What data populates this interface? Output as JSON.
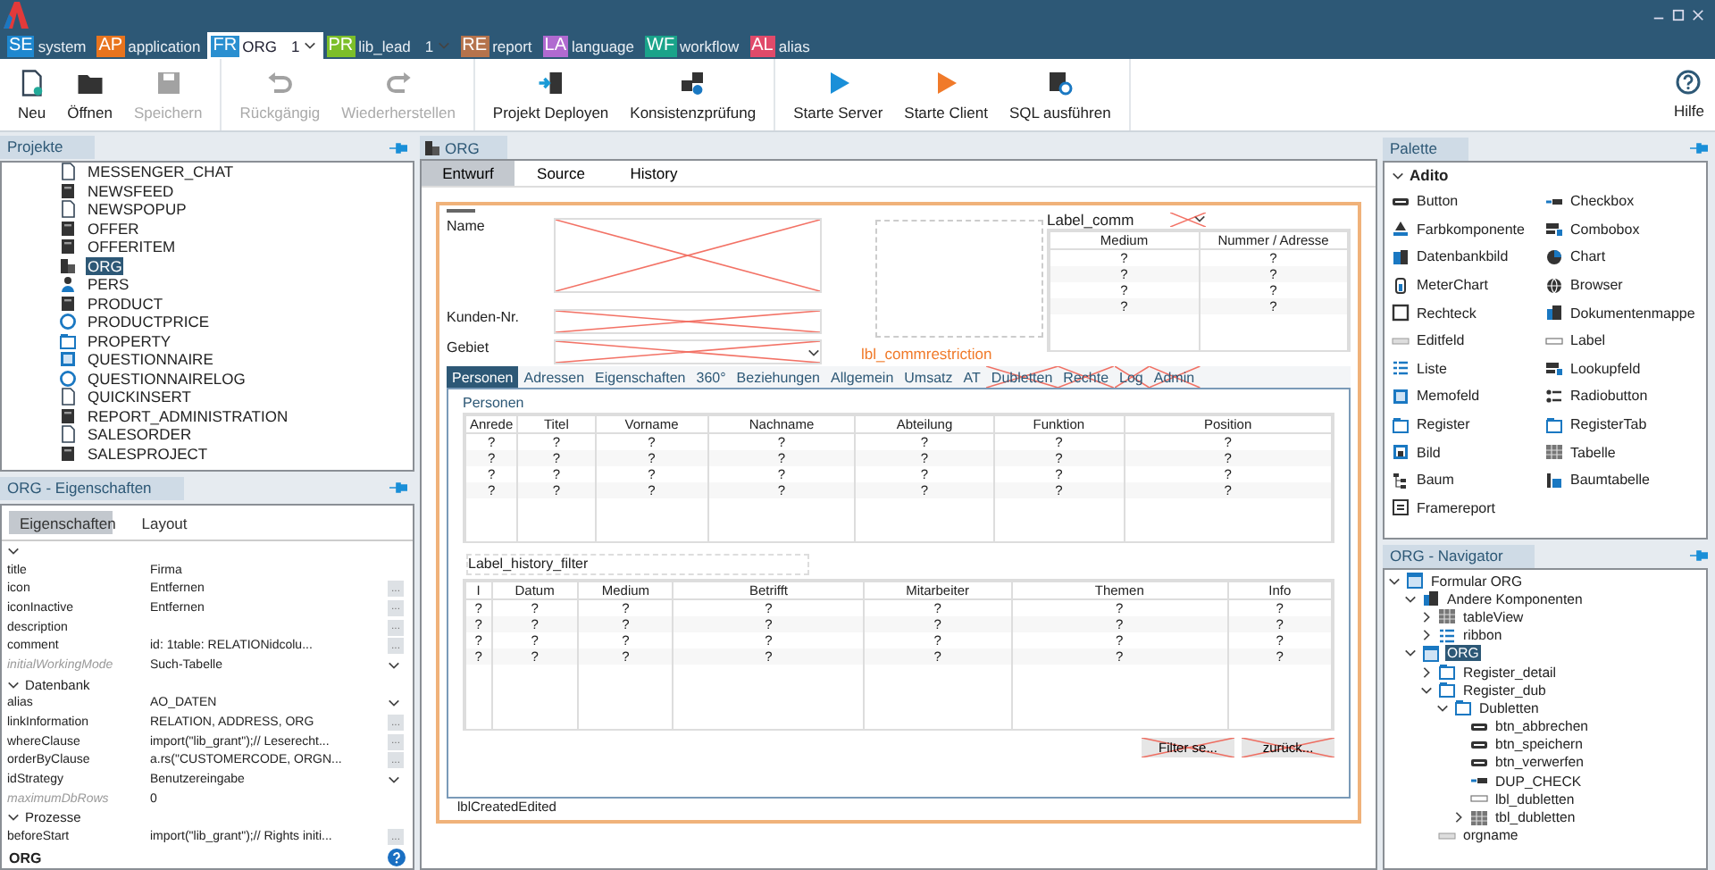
{
  "app_tabs": [
    {
      "code": "SE",
      "label": "system",
      "color": "#1e88d0",
      "selected": false
    },
    {
      "code": "AP",
      "label": "application",
      "color": "#e8741e",
      "selected": false
    },
    {
      "code": "FR",
      "label": "ORG",
      "color": "#2a8fd0",
      "selected": true,
      "count": "1"
    },
    {
      "code": "PR",
      "label": "lib_lead",
      "color": "#7cbf2a",
      "selected": false,
      "count": "1"
    },
    {
      "code": "RE",
      "label": "report",
      "color": "#b5734c",
      "selected": false
    },
    {
      "code": "LA",
      "label": "language",
      "color": "#b06ad0",
      "selected": false
    },
    {
      "code": "WF",
      "label": "workflow",
      "color": "#1aa38a",
      "selected": false
    },
    {
      "code": "AL",
      "label": "alias",
      "color": "#e04a6a",
      "selected": false
    }
  ],
  "toolbar": {
    "groups": [
      [
        {
          "label": "Neu",
          "kind": "new",
          "disabled": false
        },
        {
          "label": "Öffnen",
          "kind": "open",
          "disabled": false
        },
        {
          "label": "Speichern",
          "kind": "save",
          "disabled": true
        }
      ],
      [
        {
          "label": "Rückgängig",
          "kind": "undo",
          "disabled": true
        },
        {
          "label": "Wiederherstellen",
          "kind": "redo",
          "disabled": true
        }
      ],
      [
        {
          "label": "Projekt Deployen",
          "kind": "deploy",
          "disabled": false
        },
        {
          "label": "Konsistenzprüfung",
          "kind": "check",
          "disabled": false
        }
      ],
      [
        {
          "label": "Starte Server",
          "kind": "play",
          "color": "#1a8fd8",
          "disabled": false
        },
        {
          "label": "Starte Client",
          "kind": "play",
          "color": "#f07a2a",
          "disabled": false
        },
        {
          "label": "SQL ausführen",
          "kind": "sql",
          "disabled": false
        }
      ]
    ],
    "help": "Hilfe"
  },
  "projects": {
    "title": "Projekte",
    "items": [
      {
        "label": "MESSENGER_CHAT",
        "kind": "doc",
        "selected": false
      },
      {
        "label": "NEWSFEED",
        "kind": "block",
        "selected": false
      },
      {
        "label": "NEWSPOPUP",
        "kind": "doc",
        "selected": false
      },
      {
        "label": "OFFER",
        "kind": "block",
        "selected": false
      },
      {
        "label": "OFFERITEM",
        "kind": "block",
        "selected": false
      },
      {
        "label": "ORG",
        "kind": "building",
        "selected": true
      },
      {
        "label": "PERS",
        "kind": "person",
        "selected": false
      },
      {
        "label": "PRODUCT",
        "kind": "block",
        "selected": false
      },
      {
        "label": "PRODUCTPRICE",
        "kind": "circle",
        "selected": false
      },
      {
        "label": "PROPERTY",
        "kind": "tabs",
        "selected": false
      },
      {
        "label": "QUESTIONNAIRE",
        "kind": "memo",
        "selected": false
      },
      {
        "label": "QUESTIONNAIRELOG",
        "kind": "circle",
        "selected": false
      },
      {
        "label": "QUICKINSERT",
        "kind": "doc",
        "selected": false
      },
      {
        "label": "REPORT_ADMINISTRATION",
        "kind": "block",
        "selected": false
      },
      {
        "label": "SALESORDER",
        "kind": "doc",
        "selected": false
      },
      {
        "label": "SALESPROJECT",
        "kind": "block",
        "selected": false
      }
    ]
  },
  "properties": {
    "title": "ORG - Eigenschaften",
    "tabs": [
      {
        "label": "Eigenschaften",
        "selected": true
      },
      {
        "label": "Layout",
        "selected": false
      }
    ],
    "rows": [
      {
        "kind": "section",
        "expanded": true
      },
      {
        "kind": "prop",
        "name": "title",
        "value": "Firma",
        "disabled": false,
        "dropdown": false
      },
      {
        "kind": "prop",
        "name": "icon",
        "value": "Entfernen",
        "button": "...",
        "disabled": false,
        "dropdown": false
      },
      {
        "kind": "prop",
        "name": "iconInactive",
        "value": "Entfernen",
        "button": "...",
        "disabled": false,
        "dropdown": false
      },
      {
        "kind": "prop",
        "name": "description",
        "button": "...",
        "disabled": false,
        "dropdown": false
      },
      {
        "kind": "prop",
        "name": "comment",
        "value": "id: 1table: RELATIONidcolu...",
        "button": "...",
        "disabled": false,
        "dropdown": false
      },
      {
        "kind": "prop",
        "name": "initialWorkingMode",
        "value": "Such-Tabelle",
        "disabled": true,
        "dropdown": true
      },
      {
        "kind": "section",
        "label": "Datenbank",
        "expanded": true
      },
      {
        "kind": "prop",
        "name": "alias",
        "value": "AO_DATEN",
        "disabled": false,
        "dropdown": true
      },
      {
        "kind": "prop",
        "name": "linkInformation",
        "value": "RELATION, ADDRESS, ORG",
        "button": "...",
        "disabled": false,
        "dropdown": false
      },
      {
        "kind": "prop",
        "name": "whereClause",
        "value": "import(\"lib_grant\");// Leserecht...",
        "button": "...",
        "disabled": false,
        "dropdown": false
      },
      {
        "kind": "prop",
        "name": "orderByClause",
        "value": "a.rs(\"CUSTOMERCODE, ORGN...",
        "button": "...",
        "disabled": false,
        "dropdown": false
      },
      {
        "kind": "prop",
        "name": "idStrategy",
        "value": "Benutzereingabe",
        "disabled": false,
        "dropdown": true
      },
      {
        "kind": "prop",
        "name": "maximumDbRows",
        "value": "0",
        "disabled": true,
        "dropdown": false
      },
      {
        "kind": "section",
        "label": "Prozesse",
        "expanded": true
      },
      {
        "kind": "prop",
        "name": "beforeStart",
        "value": "import(\"lib_grant\");// Rights initi...",
        "button": "...",
        "disabled": false,
        "dropdown": false
      }
    ],
    "status": "ORG"
  },
  "editor": {
    "tab": "ORG",
    "views": [
      {
        "label": "Entwurf",
        "selected": true
      },
      {
        "label": "Source",
        "selected": false
      },
      {
        "label": "History",
        "selected": false
      }
    ],
    "fields": [
      {
        "label": "Name",
        "hidden": true,
        "dropdown": false
      },
      {
        "label": "Kunden-Nr.",
        "hidden": true,
        "dropdown": false
      },
      {
        "label": "Gebiet",
        "hidden": true,
        "dropdown": true
      }
    ],
    "comm": {
      "label": "Label_comm",
      "columns": [
        "Medium",
        "Nummer / Adresse"
      ],
      "rows": [
        [
          "?",
          "?"
        ],
        [
          "?",
          "?"
        ],
        [
          "?",
          "?"
        ],
        [
          "?",
          "?"
        ]
      ]
    },
    "restriction_label": "lbl_commrestriction",
    "register_tabs": [
      {
        "label": "Personen",
        "selected": true,
        "hidden": false
      },
      {
        "label": "Adressen",
        "selected": false,
        "hidden": false
      },
      {
        "label": "Eigenschaften",
        "selected": false,
        "hidden": false
      },
      {
        "label": "360°",
        "selected": false,
        "hidden": false
      },
      {
        "label": "Beziehungen",
        "selected": false,
        "hidden": false
      },
      {
        "label": "Allgemein",
        "selected": false,
        "hidden": false
      },
      {
        "label": "Umsatz",
        "selected": false,
        "hidden": false
      },
      {
        "label": "AT",
        "selected": false,
        "hidden": false
      },
      {
        "label": "Dubletten",
        "selected": false,
        "hidden": true
      },
      {
        "label": "Rechte",
        "selected": false,
        "hidden": true
      },
      {
        "label": "Log",
        "selected": false,
        "hidden": true
      },
      {
        "label": "Admin",
        "selected": false,
        "hidden": true
      }
    ],
    "persons": {
      "label": "Personen",
      "columns": [
        "Anrede",
        "Titel",
        "Vorname",
        "Nachname",
        "Abteilung",
        "Funktion",
        "Position"
      ],
      "rows": [
        [
          "?",
          "?",
          "?",
          "?",
          "?",
          "?",
          "?"
        ],
        [
          "?",
          "?",
          "?",
          "?",
          "?",
          "?",
          "?"
        ],
        [
          "?",
          "?",
          "?",
          "?",
          "?",
          "?",
          "?"
        ],
        [
          "?",
          "?",
          "?",
          "?",
          "?",
          "?",
          "?"
        ]
      ]
    },
    "history": {
      "label": "Label_history_filter",
      "columns": [
        "I",
        "Datum",
        "Medium",
        "Betrifft",
        "Mitarbeiter",
        "Themen",
        "Info"
      ],
      "rows": [
        [
          "?",
          "?",
          "?",
          "?",
          "?",
          "?",
          "?"
        ],
        [
          "?",
          "?",
          "?",
          "?",
          "?",
          "?",
          "?"
        ],
        [
          "?",
          "?",
          "?",
          "?",
          "?",
          "?",
          "?"
        ],
        [
          "?",
          "?",
          "?",
          "?",
          "?",
          "?",
          "?"
        ]
      ]
    },
    "buttons": [
      {
        "label": "Filter se...",
        "hidden": true
      },
      {
        "label": "zurück...",
        "hidden": true
      }
    ],
    "footer_label": "lblCreatedEdited"
  },
  "palette": {
    "title": "Palette",
    "group": "Adito",
    "expanded": true,
    "items": [
      {
        "label": "Button",
        "kind": "button"
      },
      {
        "label": "Checkbox",
        "kind": "checkbox"
      },
      {
        "label": "Farbkomponente",
        "kind": "color"
      },
      {
        "label": "Combobox",
        "kind": "combo"
      },
      {
        "label": "Datenbankbild",
        "kind": "image"
      },
      {
        "label": "Chart",
        "kind": "chart"
      },
      {
        "label": "MeterChart",
        "kind": "meter"
      },
      {
        "label": "Browser",
        "kind": "globe"
      },
      {
        "label": "Rechteck",
        "kind": "rect"
      },
      {
        "label": "Dokumentenmappe",
        "kind": "docs"
      },
      {
        "label": "Editfeld",
        "kind": "edit"
      },
      {
        "label": "Label",
        "kind": "label"
      },
      {
        "label": "Liste",
        "kind": "list"
      },
      {
        "label": "Lookupfeld",
        "kind": "combo"
      },
      {
        "label": "Memofeld",
        "kind": "memo"
      },
      {
        "label": "Radiobutton",
        "kind": "radio"
      },
      {
        "label": "Register",
        "kind": "tabs"
      },
      {
        "label": "RegisterTab",
        "kind": "tabs"
      },
      {
        "label": "Bild",
        "kind": "picture"
      },
      {
        "label": "Tabelle",
        "kind": "table"
      },
      {
        "label": "Baum",
        "kind": "tree"
      },
      {
        "label": "Baumtabelle",
        "kind": "treetable"
      },
      {
        "label": "Framereport",
        "kind": "report"
      }
    ]
  },
  "navigator": {
    "title": "ORG - Navigator",
    "tree": [
      {
        "label": "Formular ORG",
        "kind": "form",
        "expanded": true,
        "selected": false,
        "children": [
          {
            "label": "Andere Komponenten",
            "kind": "docs",
            "expanded": true,
            "selected": false,
            "children": [
              {
                "label": "tableView",
                "kind": "table",
                "expanded": false,
                "selected": false
              },
              {
                "label": "ribbon",
                "kind": "list",
                "expanded": false,
                "selected": false
              }
            ]
          },
          {
            "label": "ORG",
            "kind": "form",
            "expanded": true,
            "selected": true,
            "children": [
              {
                "label": "Register_detail",
                "kind": "tabs",
                "expanded": false,
                "selected": false
              },
              {
                "label": "Register_dub",
                "kind": "tabs",
                "expanded": true,
                "selected": false,
                "children": [
                  {
                    "label": "Dubletten",
                    "kind": "tabs",
                    "expanded": true,
                    "selected": false,
                    "children": [
                      {
                        "label": "btn_abbrechen",
                        "kind": "button",
                        "selected": false
                      },
                      {
                        "label": "btn_speichern",
                        "kind": "button",
                        "selected": false
                      },
                      {
                        "label": "btn_verwerfen",
                        "kind": "button",
                        "selected": false
                      },
                      {
                        "label": "DUP_CHECK",
                        "kind": "checkbox",
                        "selected": false
                      },
                      {
                        "label": "lbl_dubletten",
                        "kind": "label",
                        "selected": false
                      },
                      {
                        "label": "tbl_dubletten",
                        "kind": "table",
                        "expanded": false,
                        "selected": false
                      }
                    ]
                  }
                ]
              },
              {
                "label": "orgname",
                "kind": "edit",
                "selected": false
              }
            ]
          }
        ]
      }
    ]
  }
}
